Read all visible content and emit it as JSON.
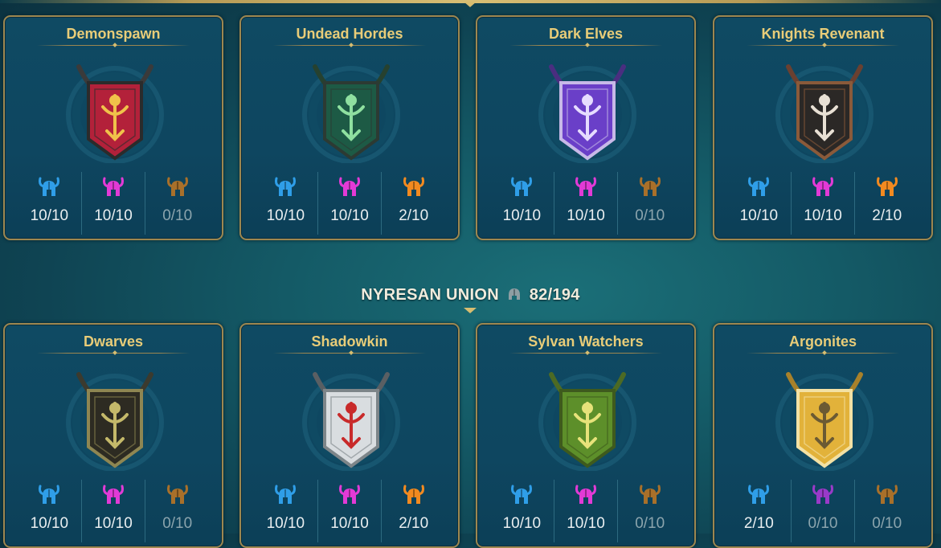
{
  "section": {
    "title": "NYRESAN UNION",
    "count": "82/194"
  },
  "colors": {
    "blue": "#2f9ee8",
    "magenta": "#e23ad6",
    "orange": "#f28a20",
    "orange_dim": "#a8702a",
    "purple": "#9a3ac8"
  },
  "factions": [
    {
      "name": "Demonspawn",
      "emblem": "demon-banner-icon",
      "stats": [
        "10/10",
        "10/10",
        "0/10"
      ]
    },
    {
      "name": "Undead Hordes",
      "emblem": "skull-banner-icon",
      "stats": [
        "10/10",
        "10/10",
        "2/10"
      ]
    },
    {
      "name": "Dark Elves",
      "emblem": "elf-banner-icon",
      "stats": [
        "10/10",
        "10/10",
        "0/10"
      ]
    },
    {
      "name": "Knights Revenant",
      "emblem": "knight-banner-icon",
      "stats": [
        "10/10",
        "10/10",
        "2/10"
      ]
    },
    {
      "name": "Dwarves",
      "emblem": "dwarf-banner-icon",
      "stats": [
        "10/10",
        "10/10",
        "0/10"
      ]
    },
    {
      "name": "Shadowkin",
      "emblem": "oni-banner-icon",
      "stats": [
        "10/10",
        "10/10",
        "2/10"
      ]
    },
    {
      "name": "Sylvan Watchers",
      "emblem": "tree-banner-icon",
      "stats": [
        "10/10",
        "10/10",
        "0/10"
      ]
    },
    {
      "name": "Argonites",
      "emblem": "golden-banner-icon",
      "stats": [
        "2/10",
        "0/10",
        "0/10"
      ]
    }
  ]
}
